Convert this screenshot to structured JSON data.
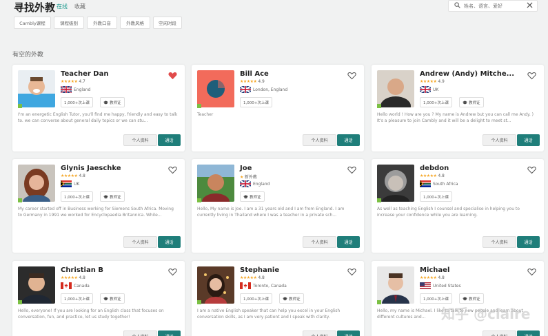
{
  "header": {
    "title": "寻找外教",
    "tabs": [
      {
        "label": "在线",
        "active": true
      },
      {
        "label": "收藏",
        "active": false
      }
    ],
    "search_placeholder": "姓名、语言、爱好",
    "accent_color": "#1e9a8f"
  },
  "filters": [
    "Cambly课程",
    "课程级别",
    "外教口音",
    "外教风格",
    "空闲时段"
  ],
  "section_title": "有空的外教",
  "buttons": {
    "profile": "个人资料",
    "contact": "通话"
  },
  "tutors": [
    {
      "name": "Teacher Dan",
      "rating": "4.7",
      "stars": "★★★★★",
      "country": "England",
      "flag": "uk",
      "lessons": "1,000+次上课",
      "cert": "教师证",
      "favorited": true,
      "bio": "I'm an energetic English Tutor, you'll find me happy, friendly and easy to talk to. we can converse about general daily topics or we can stu..."
    },
    {
      "name": "Bill Ace",
      "rating": "4.9",
      "stars": "★★★★★",
      "country": "London, England",
      "flag": "uk",
      "lessons": "1,000+次上课",
      "cert": "",
      "favorited": false,
      "bio": "Teacher"
    },
    {
      "name": "Andrew (Andy) Mitche...",
      "rating": "4.9",
      "stars": "★★★★★",
      "country": "UK",
      "flag": "uk",
      "lessons": "1,000+次上课",
      "cert": "教师证",
      "favorited": false,
      "bio": "Hello world ! How are you ? My name is Andrew but you can call me Andy. ) It's a pleasure to join Cambly and it will be a delight to meet st..."
    },
    {
      "name": "Glynis Jaeschke",
      "rating": "4.8",
      "stars": "★★★★★",
      "country": "UK",
      "flag": "za",
      "lessons": "1,000+次上课",
      "cert": "教师证",
      "favorited": false,
      "bio": "My career started off in Business working for Siemens South Africa. Moving to Germany in 1991 we worked for Encyclopaedia Britannica. While..."
    },
    {
      "name": "Joe",
      "rating": "新外教",
      "stars": "★",
      "country": "England",
      "flag": "uk",
      "lessons": "",
      "cert": "教师证",
      "favorited": false,
      "bio": "Hello, My name is Joe. I am a 31 years old and I am from England. I am currently living in Thailand where I was a teacher in a private sch..."
    },
    {
      "name": "debdon",
      "rating": "4.8",
      "stars": "★★★★★",
      "country": "South Africa",
      "flag": "za",
      "lessons": "1,000+次上课",
      "cert": "",
      "favorited": false,
      "bio": "As well as teaching English I counsel and specialise in helping you to increase your confidence while you are learning."
    },
    {
      "name": "Christian B",
      "rating": "4.8",
      "stars": "★★★★★",
      "country": "Canada",
      "flag": "ca",
      "lessons": "1,000+次上课",
      "cert": "教师证",
      "favorited": false,
      "bio": "Hello, everyone! If you are looking for an English class that focuses on conversation, fun, and practice, let us study together!"
    },
    {
      "name": "Stephanie",
      "rating": "4.8",
      "stars": "★★★★★",
      "country": "Toronto, Canada",
      "flag": "ca",
      "lessons": "1,000+次上课",
      "cert": "教师证",
      "favorited": false,
      "bio": "I am a native English speaker that can help you excel in your English conversation skills, as I am very patient and I speak with clarity."
    },
    {
      "name": "Michael",
      "rating": "4.8",
      "stars": "★★★★★",
      "country": "United States",
      "flag": "us",
      "lessons": "1,000+次上课",
      "cert": "教师证",
      "favorited": false,
      "bio": "Hello, my name is Michael. I like to talk to new people and learn about different cultures and..."
    }
  ],
  "watermark": "知乎 @claire"
}
